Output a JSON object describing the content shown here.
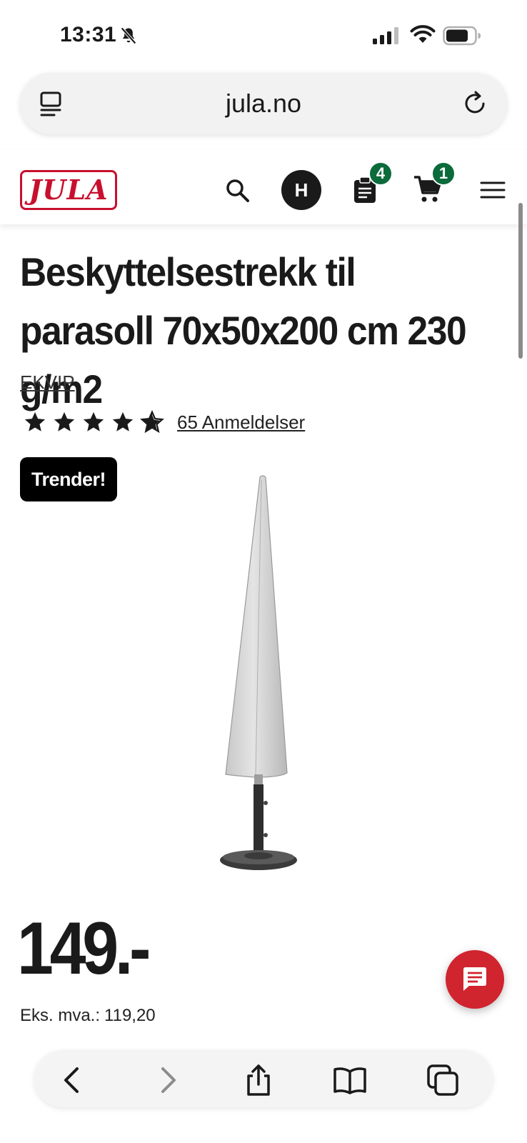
{
  "status_bar": {
    "time": "13:31"
  },
  "browser": {
    "url": "jula.no"
  },
  "header": {
    "logo_text": "JULA",
    "avatar_initial": "H",
    "list_count": "4",
    "cart_count": "1"
  },
  "product": {
    "title": "Beskyttelsestrekk til parasoll 70x50x200 cm 230 g/m2",
    "brand": "EKVIP",
    "rating": 4.5,
    "reviews": "65 Anmeldelser",
    "badge": "Trender!",
    "price": "149.-",
    "price_ex_vat_label": "Eks. mva.:",
    "price_ex_vat_value": "119,20"
  },
  "colors": {
    "brand_red": "#c8102e",
    "badge_green": "#0c6b3b",
    "chat_red": "#d0242f"
  }
}
